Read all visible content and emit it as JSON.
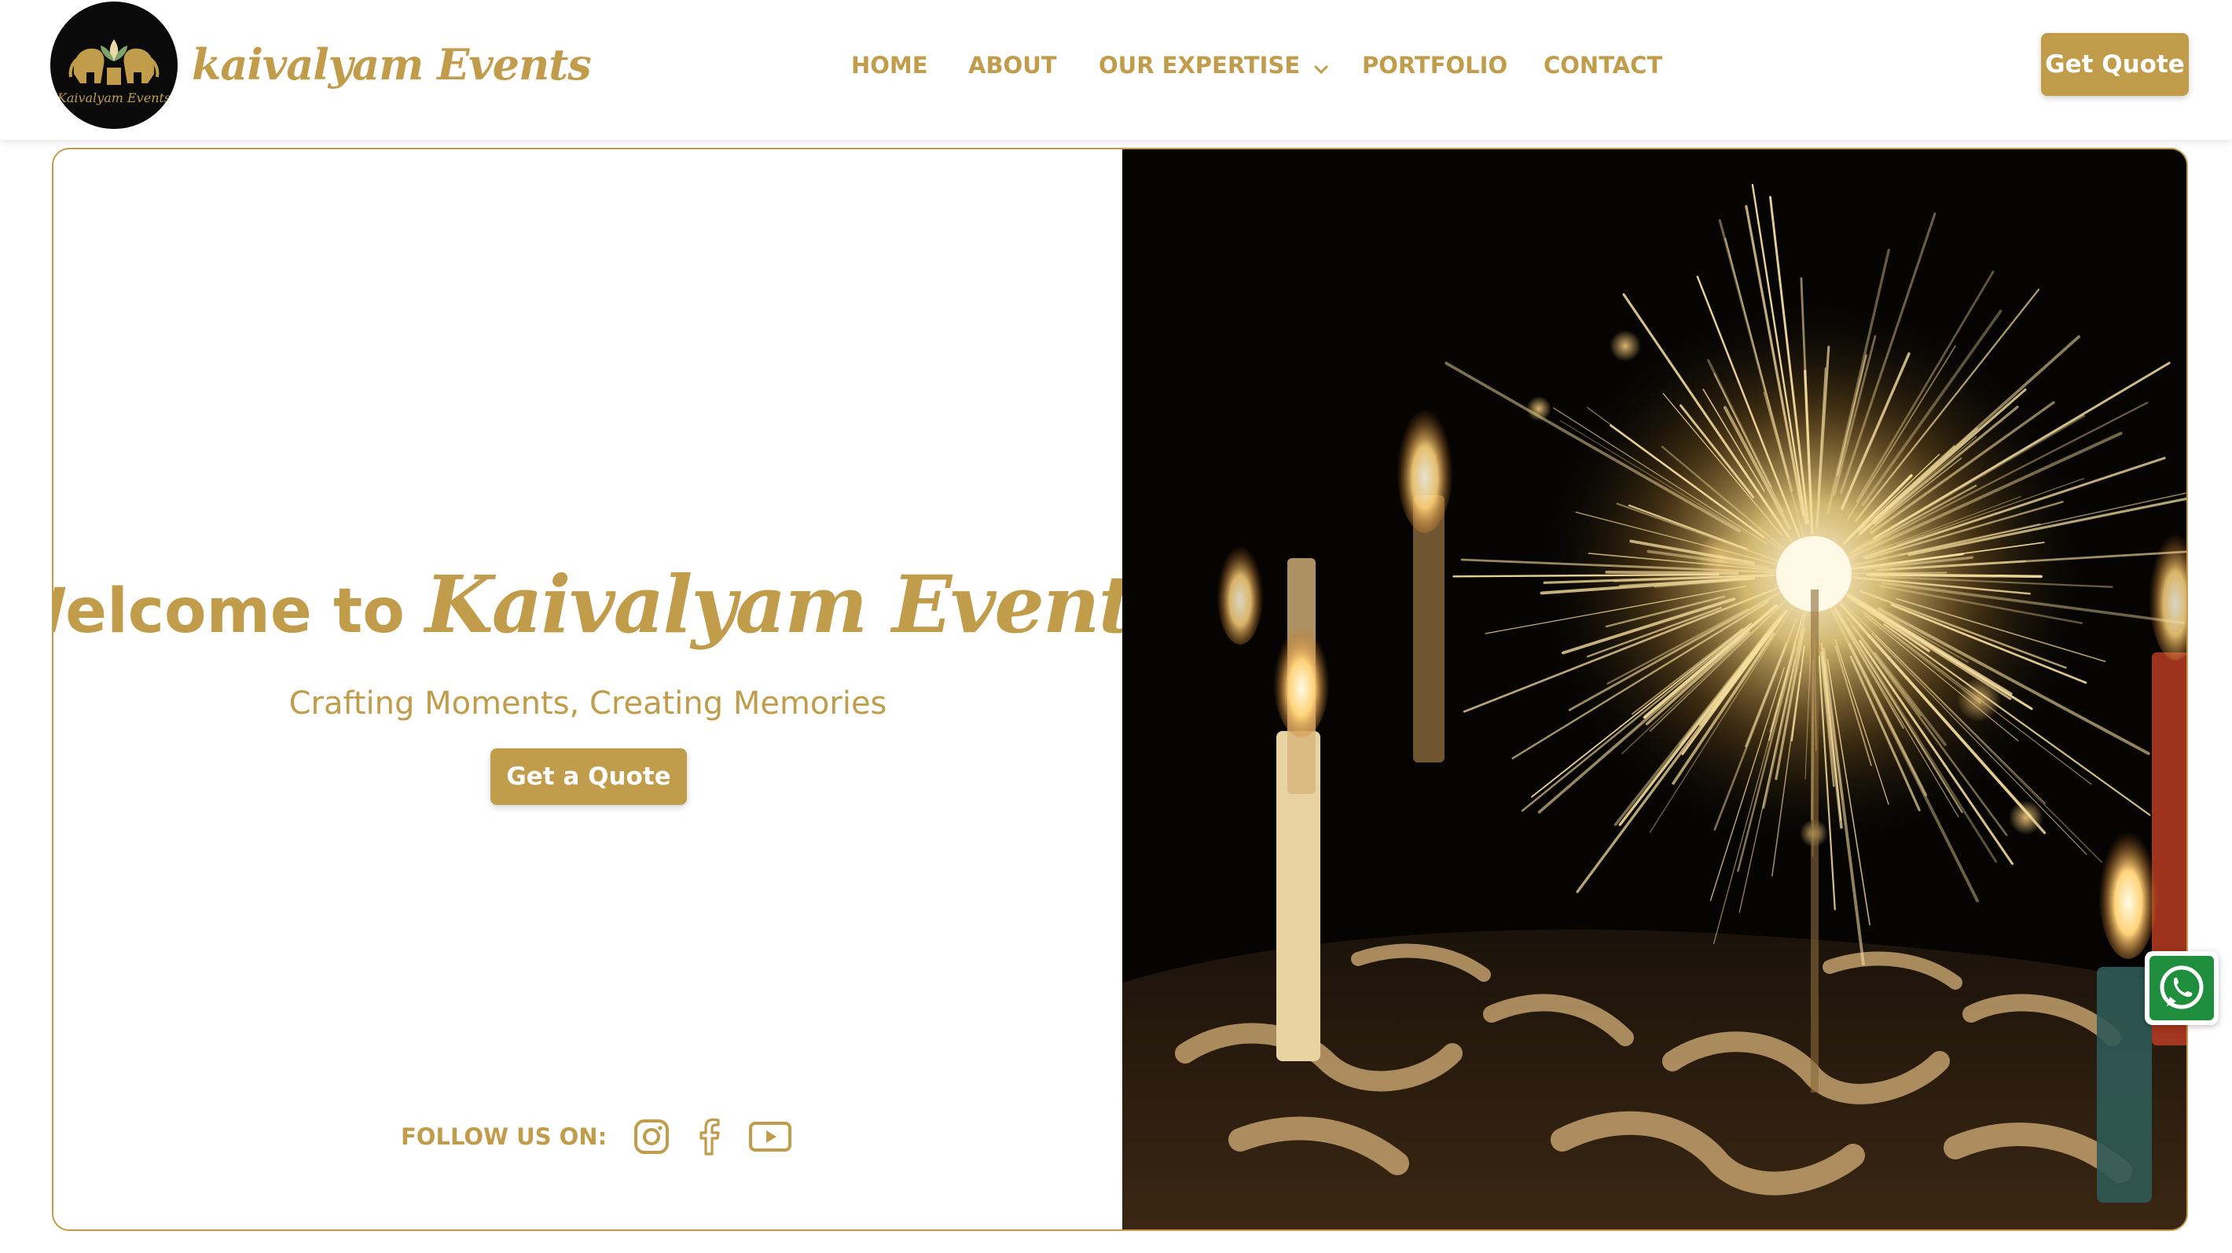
{
  "header": {
    "brand": "kaivalyam Events",
    "logo_text": "Kaivalyam Events",
    "nav": [
      {
        "label": "HOME"
      },
      {
        "label": "ABOUT"
      },
      {
        "label": "OUR EXPERTISE",
        "has_dropdown": true
      },
      {
        "label": "PORTFOLIO"
      },
      {
        "label": "CONTACT"
      }
    ],
    "cta_label": "Get Quote"
  },
  "hero": {
    "welcome_prefix": "Welcome to",
    "welcome_brand": "Kaivalyam Events",
    "tagline": "Crafting Moments, Creating Memories",
    "cta_label": "Get a Quote",
    "follow_label": "FOLLOW US ON:",
    "socials": [
      "instagram-icon",
      "facebook-icon",
      "youtube-icon"
    ],
    "image_subject": "sparkler-and-candles-photo"
  },
  "floating": {
    "icon": "whatsapp-icon"
  },
  "colors": {
    "accent": "#c19c4b",
    "button_text": "#ffffff",
    "background": "#ffffff",
    "whatsapp": "#1f8f3e"
  }
}
